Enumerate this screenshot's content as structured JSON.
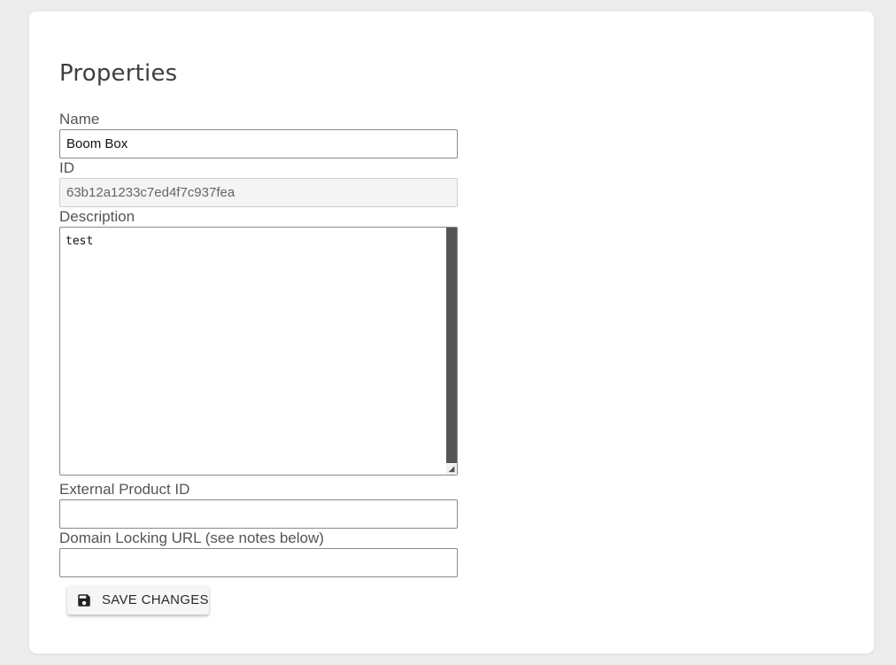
{
  "form": {
    "title": "Properties",
    "fields": {
      "name": {
        "label": "Name",
        "value": "Boom Box"
      },
      "id": {
        "label": "ID",
        "value": "63b12a1233c7ed4f7c937fea"
      },
      "description": {
        "label": "Description",
        "value": "test"
      },
      "external_product_id": {
        "label": "External Product ID",
        "value": ""
      },
      "domain_locking_url": {
        "label": "Domain Locking URL (see notes below)",
        "value": ""
      }
    },
    "save_button": {
      "label": "SAVE CHANGES",
      "icon": "floppy-disk-icon"
    }
  },
  "colors": {
    "page_background": "#ececec",
    "card_background": "#ffffff",
    "title": "#3f3f3f",
    "label": "#555555",
    "input_border": "#8a8a8a",
    "readonly_background": "#f4f4f4",
    "scrollbar": "#555555"
  }
}
